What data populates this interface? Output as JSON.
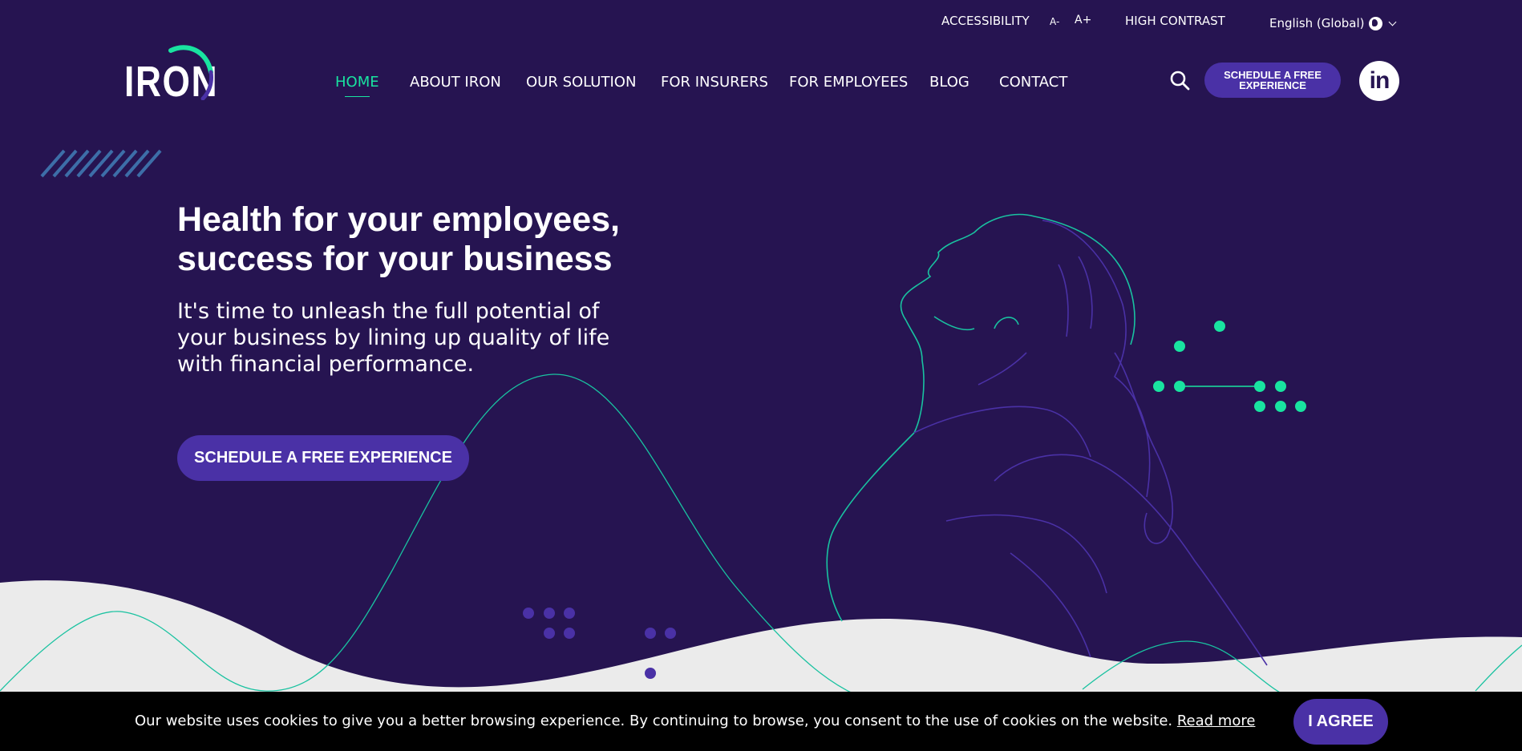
{
  "topbar": {
    "accessibility": "ACCESSIBILITY",
    "font_smaller": "A-",
    "font_larger": "A+",
    "high_contrast": "HIGH CONTRAST",
    "language": "English (Global)"
  },
  "logo": {
    "text": "IRON"
  },
  "nav": {
    "items": [
      {
        "label": "HOME",
        "active": true
      },
      {
        "label": "ABOUT IRON"
      },
      {
        "label": "OUR SOLUTION"
      },
      {
        "label": "FOR INSURERS"
      },
      {
        "label": "FOR EMPLOYEES"
      },
      {
        "label": "BLOG"
      },
      {
        "label": "CONTACT"
      }
    ],
    "schedule_button": "SCHEDULE A FREE EXPERIENCE",
    "linkedin": "in"
  },
  "hero": {
    "title_line1": "Health for your employees,",
    "title_line2": "success for your business",
    "subtitle": "It's time to unleash the full potential of your business by lining up quality of life with financial performance.",
    "cta": "SCHEDULE A FREE EXPERIENCE"
  },
  "cookie": {
    "text": "Our website uses cookies to give you a better browsing experience. By continuing to browse, you consent to the use of cookies on the website. ",
    "link": "Read more",
    "agree": "I AGREE"
  },
  "colors": {
    "background": "#261451",
    "accent_green": "#19e3a0",
    "button_purple": "#4a31a6",
    "wave_grey": "#ebebeb"
  },
  "icons": [
    "globe-icon",
    "chevron-down-icon",
    "search-icon",
    "linkedin-icon"
  ]
}
